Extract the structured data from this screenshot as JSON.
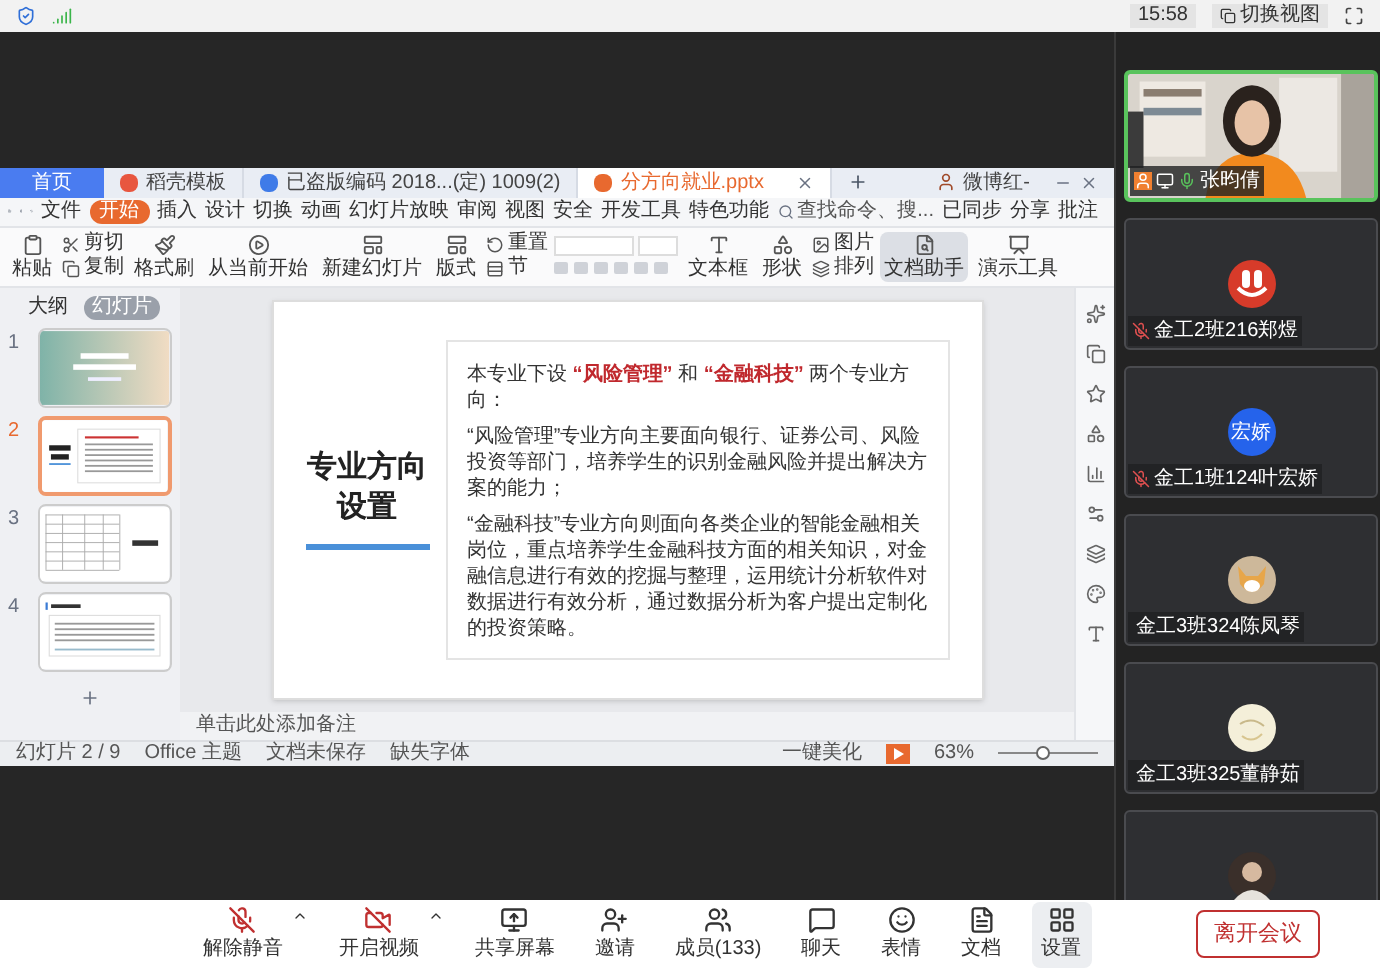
{
  "top_bar": {
    "time": "15:58",
    "switch_view": "切换视图"
  },
  "wps": {
    "tabs": [
      {
        "label": "首页",
        "kind": "home",
        "selected": false
      },
      {
        "label": "稻壳模板",
        "kind": "doc",
        "selected": false
      },
      {
        "label": "已盗版编码 2018...(定) 1009(2)",
        "kind": "word",
        "selected": false
      },
      {
        "label": "分方向就业.pptx",
        "kind": "ppt",
        "selected": true
      }
    ],
    "user": "微博红-",
    "menu": [
      {
        "label": "文件",
        "selected": false
      },
      {
        "label": "开始",
        "selected": true
      },
      {
        "label": "插入",
        "selected": false
      },
      {
        "label": "设计",
        "selected": false
      },
      {
        "label": "切换",
        "selected": false
      },
      {
        "label": "动画",
        "selected": false
      },
      {
        "label": "幻灯片放映",
        "selected": false
      },
      {
        "label": "审阅",
        "selected": false
      },
      {
        "label": "视图",
        "selected": false
      },
      {
        "label": "安全",
        "selected": false
      },
      {
        "label": "开发工具",
        "selected": false
      },
      {
        "label": "特色功能",
        "selected": false
      }
    ],
    "search": "查找命令、搜...",
    "menu_right": [
      "已同步",
      "分享",
      "批注"
    ],
    "ribbon": [
      {
        "kind": "big",
        "label": "粘贴"
      },
      {
        "kind": "pair",
        "labels": [
          "剪切",
          "复制"
        ]
      },
      {
        "kind": "big",
        "label": "格式刷"
      },
      {
        "kind": "big",
        "label": "从当前开始"
      },
      {
        "kind": "big",
        "label": "新建幻灯片"
      },
      {
        "kind": "big",
        "label": "版式"
      },
      {
        "kind": "pair",
        "labels": [
          "重置",
          "节"
        ]
      },
      {
        "kind": "font"
      },
      {
        "kind": "big",
        "label": "文本框"
      },
      {
        "kind": "big",
        "label": "形状"
      },
      {
        "kind": "pair",
        "labels": [
          "图片",
          "排列"
        ]
      },
      {
        "kind": "big",
        "label": "文档助手",
        "selected": true
      },
      {
        "kind": "big",
        "label": "演示工具",
        "selected": false
      }
    ],
    "panel_tabs": [
      {
        "label": "大纲",
        "selected": false
      },
      {
        "label": "幻灯片",
        "selected": true
      }
    ],
    "thumbnails": [
      {
        "number": "1",
        "kind": "cover",
        "selected": false
      },
      {
        "number": "2",
        "kind": "text",
        "selected": true
      },
      {
        "number": "3",
        "kind": "table",
        "selected": false
      },
      {
        "number": "4",
        "kind": "list",
        "selected": false
      }
    ],
    "slide": {
      "title": [
        "专业方向",
        "设置"
      ],
      "intro": [
        {
          "text": "本专业下设 ",
          "highlight": false
        },
        {
          "text": "“风险管理”",
          "highlight": true
        },
        {
          "text": " 和 ",
          "highlight": false
        },
        {
          "text": "“金融科技”",
          "highlight": true
        },
        {
          "text": " 两个专业方向：",
          "highlight": false
        }
      ],
      "paragraphs": [
        "“风险管理”专业方向主要面向银行、证券公司、风险投资等部门，培养学生的识别金融风险并提出解决方案的能力；",
        "“金融科技”专业方向则面向各类企业的智能金融相关岗位，重点培养学生金融科技方面的相关知识，对金融信息进行有效的挖掘与整理，运用统计分析软件对数据进行有效分析，通过数据分析为客户提出定制化的投资策略。"
      ]
    },
    "notes_placeholder": "单击此处添加备注",
    "status": {
      "slide_no": "幻灯片 2 / 9",
      "theme": "Office 主题",
      "saved": "文档未保存",
      "fonts": "缺失字体",
      "beautify": "一键美化",
      "zoom": "63%",
      "zoom_slider": {
        "level": 0.45
      }
    }
  },
  "participants": [
    {
      "name": "张昀倩",
      "kind": "video",
      "muted": false,
      "active": true
    },
    {
      "name": "金工2班216郑煜",
      "kind": "smiley",
      "muted": true,
      "active": false
    },
    {
      "name": "金工1班124叶宏娇",
      "kind": "initials",
      "initials": "宏娇",
      "muted": true,
      "active": false
    },
    {
      "name": "金工3班324陈凤琴",
      "kind": "dog",
      "muted": false,
      "active": false
    },
    {
      "name": "金工3班325董静茹",
      "kind": "sketch",
      "muted": false,
      "active": false
    },
    {
      "kind": "person",
      "active": false
    }
  ],
  "toolbar": [
    {
      "label": "解除静音",
      "kind": "mic",
      "off": true,
      "caret": true,
      "selected": false
    },
    {
      "label": "开启视频",
      "kind": "video",
      "off": true,
      "caret": true,
      "selected": false
    },
    {
      "label": "共享屏幕",
      "kind": "share",
      "off": false,
      "caret": false,
      "selected": false
    },
    {
      "label": "邀请",
      "kind": "invite",
      "off": false,
      "caret": false,
      "selected": false
    },
    {
      "label": "成员(133)",
      "kind": "members",
      "off": false,
      "caret": false,
      "selected": false
    },
    {
      "label": "聊天",
      "kind": "chat",
      "off": false,
      "caret": false,
      "selected": false
    },
    {
      "label": "表情",
      "kind": "emoji",
      "off": false,
      "caret": false,
      "selected": false
    },
    {
      "label": "文档",
      "kind": "doc",
      "off": false,
      "caret": false,
      "selected": false
    },
    {
      "label": "设置",
      "kind": "settings",
      "off": false,
      "caret": false,
      "selected": true
    }
  ],
  "leave": "离开会议"
}
